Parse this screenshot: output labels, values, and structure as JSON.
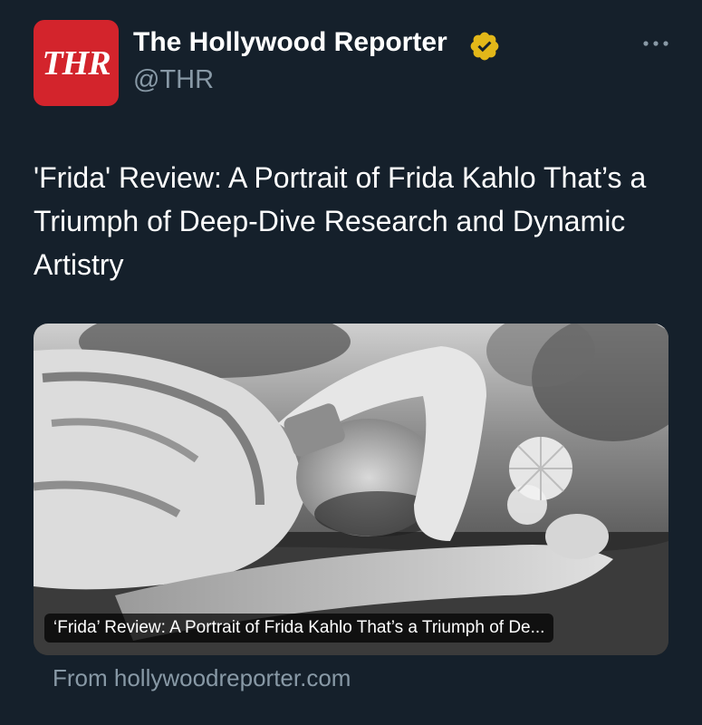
{
  "account": {
    "avatar_text": "THR",
    "display_name": "The Hollywood Reporter",
    "handle": "@THR",
    "verified_icon": "gold-verified-badge-icon",
    "avatar_color": "#d3242c",
    "badge_color": "#e2b719"
  },
  "tweet": {
    "text": "'Frida' Review: A Portrait of Frida Kahlo That’s a Triumph of Deep-Dive Research and Dynamic Artistry"
  },
  "card": {
    "caption": "‘Frida’ Review: A Portrait of Frida Kahlo That’s a Triumph of De...",
    "source": "From hollywoodreporter.com"
  },
  "menu": {
    "icon": "more-options-icon"
  },
  "theme": {
    "background": "#15202b",
    "secondary_text": "#8899a6"
  }
}
